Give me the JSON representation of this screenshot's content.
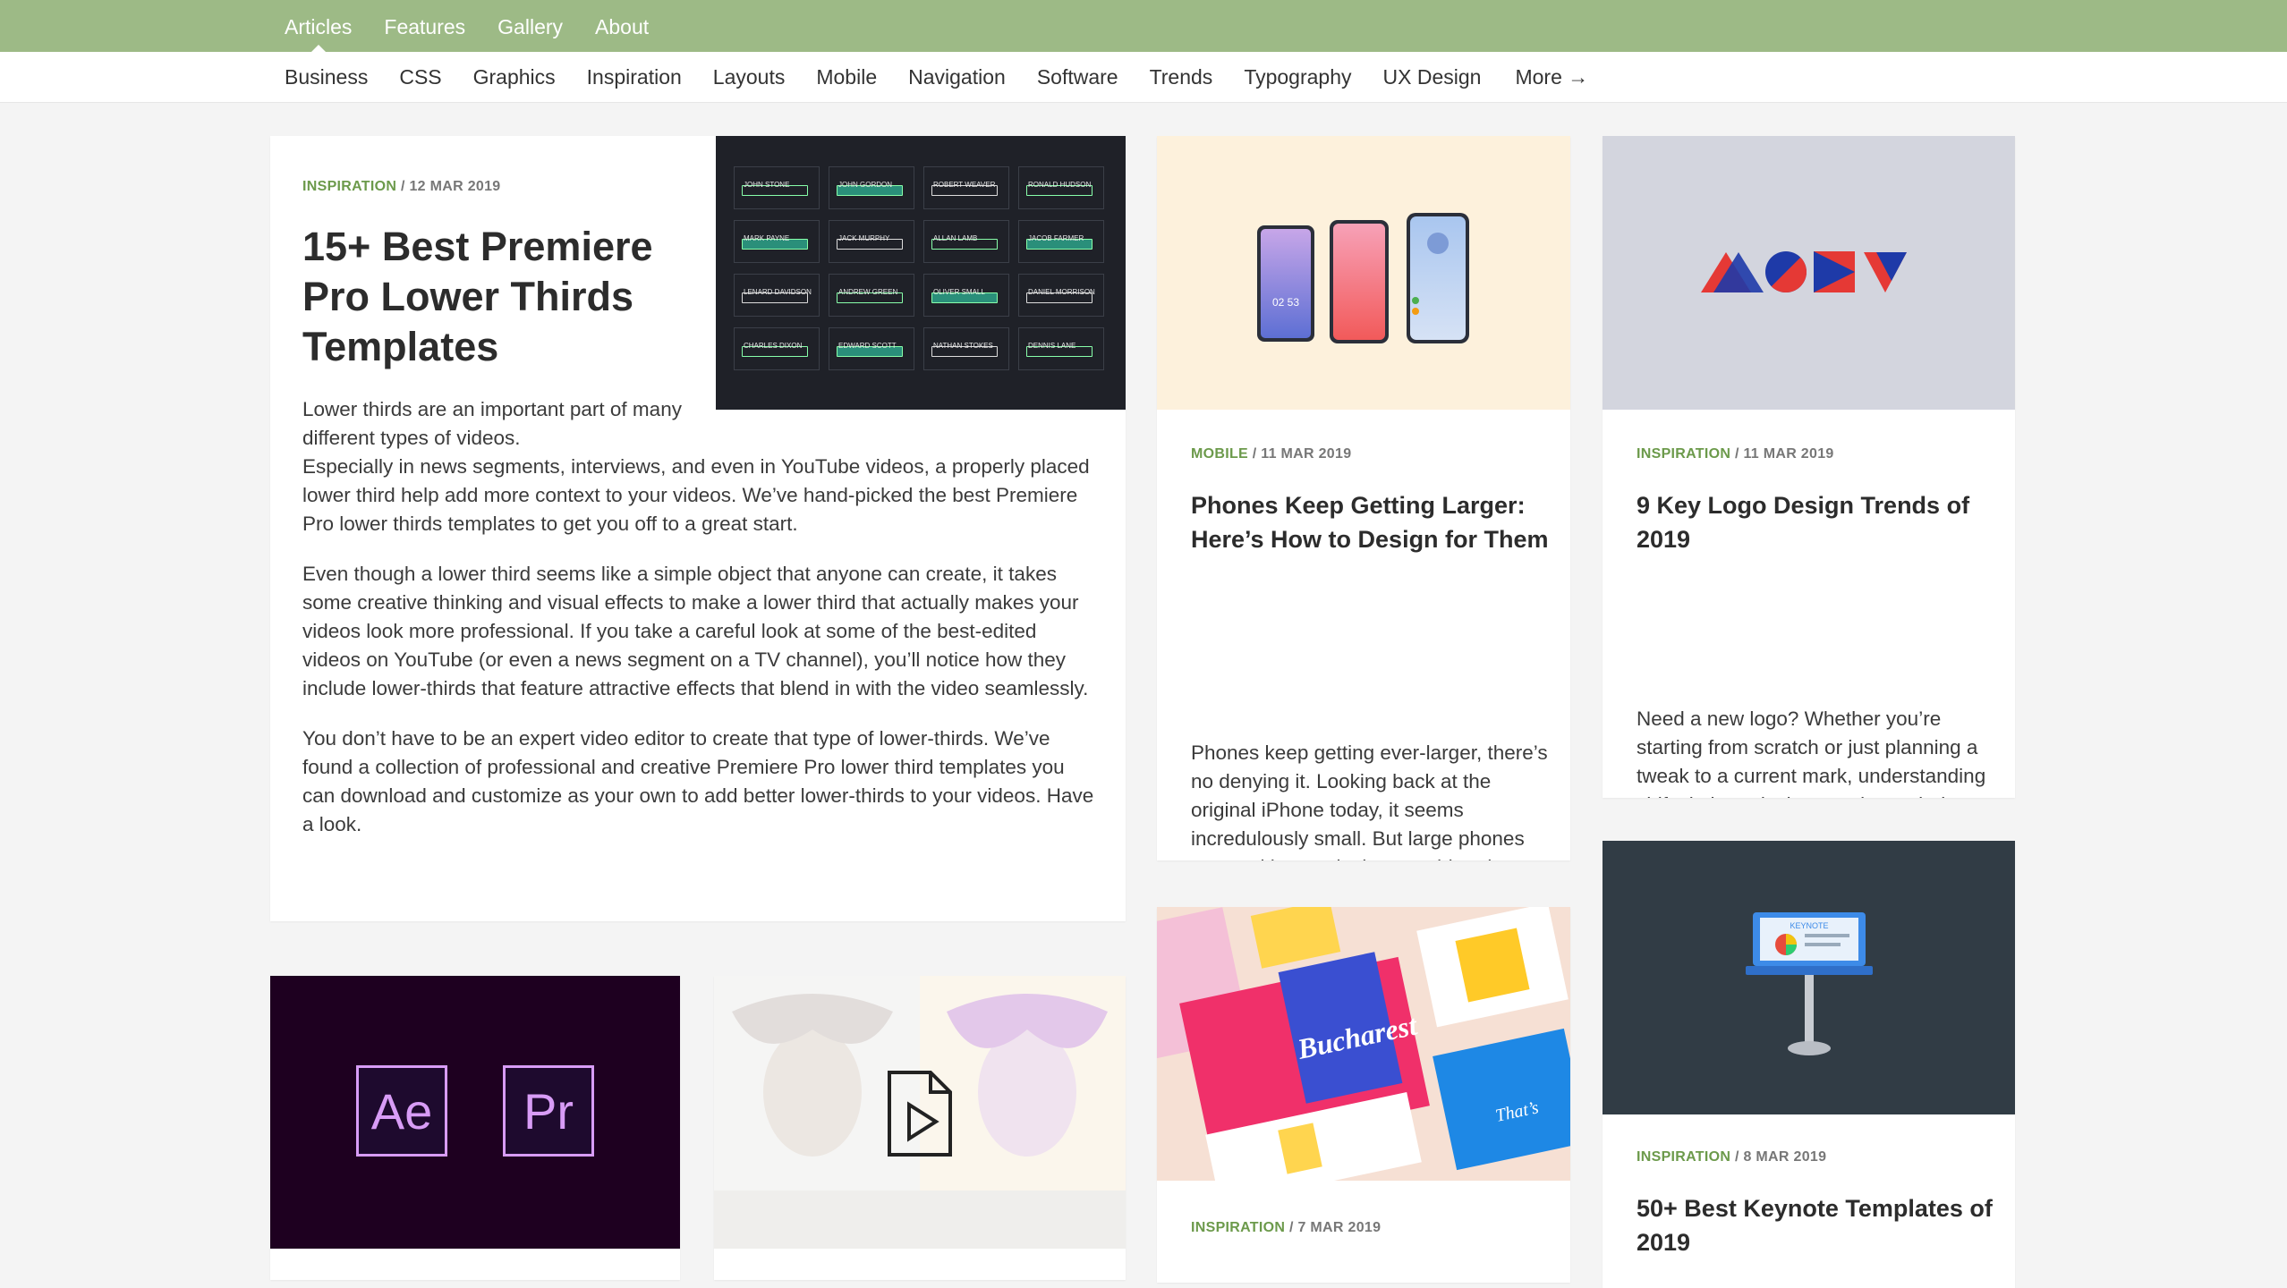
{
  "top_nav": {
    "items": [
      {
        "label": "Articles",
        "active": true
      },
      {
        "label": "Features",
        "active": false
      },
      {
        "label": "Gallery",
        "active": false
      },
      {
        "label": "About",
        "active": false
      }
    ]
  },
  "sub_nav": {
    "items": [
      "Business",
      "CSS",
      "Graphics",
      "Inspiration",
      "Layouts",
      "Mobile",
      "Navigation",
      "Software",
      "Trends",
      "Typography",
      "UX Design"
    ],
    "more_label": "More →"
  },
  "featured": {
    "category": "INSPIRATION",
    "date": " / 12 MAR 2019",
    "title": "15+ Best Premiere Pro Lower Thirds Templates",
    "paragraphs": [
      "Lower thirds are an important part of many different types of videos. Especially in news segments, interviews, and even in YouTube videos, a properly placed lower third help add more context to your videos. We’ve hand-picked the best Premiere Pro lower thirds templates to get you off to a great start.",
      "Even though a lower third seems like a simple object that anyone can create, it takes some creative thinking and visual effects to make a lower third that actually makes your videos look more professional. If you take a careful look at some of the best-edited videos on YouTube (or even a news segment on a TV channel), you’ll notice how they include lower-thirds that feature attractive effects that blend in with the video seamlessly.",
      "You don’t have to be an expert video editor to create that type of lower-thirds. We’ve found a collection of professional and creative Premiere Pro lower third templates you can download and customize as your own to add better lower-thirds to your videos. Have a look."
    ],
    "lower_third_names": [
      "JOHN STONE",
      "JOHN GORDON",
      "ROBERT WEAVER",
      "RONALD HUDSON",
      "MARK PAYNE",
      "JACK MURPHY",
      "ALLAN LAMB",
      "JACOB FARMER",
      "LENARD DAVIDSON",
      "ANDREW GREEN",
      "OLIVER SMALL",
      "DANIEL MORRISON",
      "CHARLES DIXON",
      "EDWARD SCOTT",
      "NATHAN STOKES",
      "DENNIS LANE"
    ]
  },
  "phones": {
    "category": "MOBILE",
    "date": " / 11 MAR 2019",
    "title": "Phones Keep Getting Larger: Here’s How to Design for Them",
    "excerpt": "Phones keep getting ever-larger, there’s no denying it. Looking back at the original iPhone today, it seems incredulously small. But large phones come with new design considerations and requirements. Let’s dive into them.",
    "phone_clock": "02 53"
  },
  "logo": {
    "category": "INSPIRATION",
    "date": " / 11 MAR 2019",
    "title": "9 Key Logo Design Trends of 2019",
    "excerpt": "Need a new logo? Whether you’re starting from scratch or just planning a tweak to a current mark, understanding shifts in logo design trends can help you create a design with a modern touch."
  },
  "keynote": {
    "category": "INSPIRATION",
    "date": " / 8 MAR 2019",
    "title": "50+ Best Keynote Templates of 2019",
    "icon_label": "KEYNOTE"
  },
  "bucharest": {
    "category": "INSPIRATION",
    "date": " / 7 MAR 2019",
    "slide_title": "Bucharest",
    "slide_side_text": "That’s"
  },
  "adobe": {
    "ae": "Ae",
    "pr": "Pr"
  },
  "colors": {
    "topbar": "#9dba86",
    "category": "#6c9a4b"
  }
}
